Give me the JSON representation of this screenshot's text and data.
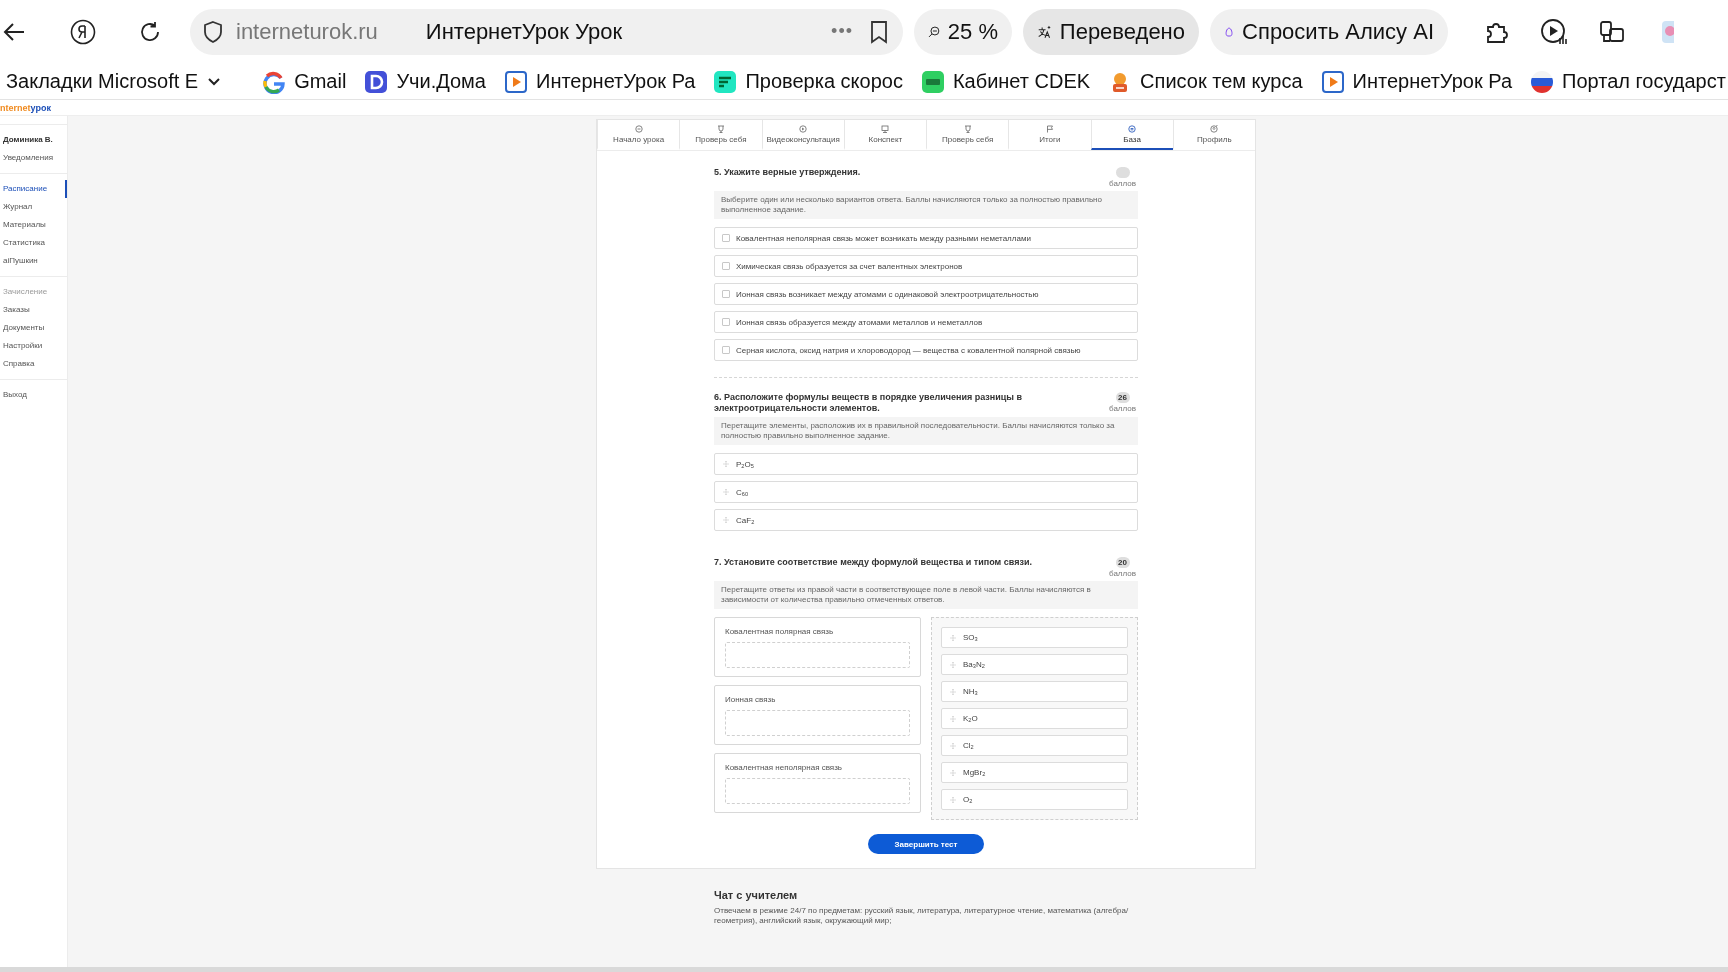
{
  "browser": {
    "host": "interneturok.ru",
    "title": "ИнтернетУрок Урок",
    "more": "•••",
    "zoom": "25 %",
    "translate": "Переведено",
    "alice": "Спросить Алису AI"
  },
  "bookmarks": [
    {
      "label": "Закладки Microsoft E",
      "kind": "folder"
    },
    {
      "label": "Gmail",
      "kind": "ring"
    },
    {
      "label": "Учи.Дома",
      "kind": "tile"
    },
    {
      "label": "ИнтернетУрок Ра",
      "kind": "play"
    },
    {
      "label": "Проверка скорос",
      "kind": "lines"
    },
    {
      "label": "Кабинет CDEK",
      "kind": "square"
    },
    {
      "label": "Список тем курса",
      "kind": "badge"
    },
    {
      "label": "ИнтернетУрок Ра",
      "kind": "play"
    },
    {
      "label": "Портал государст",
      "kind": "flag"
    }
  ],
  "site": {
    "logo_first": "nternet",
    "logo_second": "урок"
  },
  "sidebar": {
    "groups": [
      [
        {
          "label": "Доминика В.",
          "kind": "user",
          "selected": false,
          "disabled": false
        },
        {
          "label": "Уведомления",
          "kind": "item",
          "selected": false,
          "disabled": false
        }
      ],
      [
        {
          "label": "Расписание",
          "kind": "item",
          "selected": true,
          "disabled": false
        },
        {
          "label": "Журнал",
          "kind": "item",
          "selected": false,
          "disabled": false
        },
        {
          "label": "Материалы",
          "kind": "item",
          "selected": false,
          "disabled": false
        },
        {
          "label": "Статистика",
          "kind": "item",
          "selected": false,
          "disabled": false
        },
        {
          "label": "aiПушкин",
          "kind": "item",
          "selected": false,
          "disabled": false
        }
      ],
      [
        {
          "label": "Зачисление",
          "kind": "item",
          "selected": false,
          "disabled": true
        },
        {
          "label": "Заказы",
          "kind": "item",
          "selected": false,
          "disabled": false
        },
        {
          "label": "Документы",
          "kind": "item",
          "selected": false,
          "disabled": false
        },
        {
          "label": "Настройки",
          "kind": "item",
          "selected": false,
          "disabled": false
        },
        {
          "label": "Справка",
          "kind": "item",
          "selected": false,
          "disabled": false
        }
      ],
      [
        {
          "label": "Выход",
          "kind": "item",
          "selected": false,
          "disabled": false
        }
      ]
    ]
  },
  "tabs": [
    {
      "label": "Начало урока",
      "selected": false
    },
    {
      "label": "Проверь себя",
      "selected": false
    },
    {
      "label": "Видеоконсультация",
      "selected": false
    },
    {
      "label": "Конспект",
      "selected": false
    },
    {
      "label": "Проверь себя",
      "selected": false
    },
    {
      "label": "Итоги",
      "selected": false
    },
    {
      "label": "База",
      "selected": true
    },
    {
      "label": "Профиль",
      "selected": false
    }
  ],
  "questions": [
    {
      "kind": "choice",
      "title": "5. Укажите верные утверждения.",
      "points_label": "баллов",
      "hint": "Выберите один или несколько вариантов ответа. Баллы начисляются только за полностью правильно выполненное задание.",
      "options": [
        {
          "text": "Ковалентная неполярная связь может возникать между разными неметаллами",
          "checked": false
        },
        {
          "text": "Химическая связь образуется за счет валентных электронов",
          "checked": false
        },
        {
          "text": "Ионная связь возникает между атомами с одинаковой электроотрицательностью",
          "checked": false
        },
        {
          "text": "Ионная связь образуется между атомами металлов и неметаллов",
          "checked": false
        },
        {
          "text": "Серная кислота, оксид натрия и хлороводород — вещества с ковалентной полярной связью",
          "checked": false
        }
      ]
    },
    {
      "kind": "order",
      "title": "6. Расположите формулы веществ в порядке увеличения разницы в электроотрицательности элементов.",
      "points": "26",
      "points_label": "баллов",
      "hint": "Перетащите элементы, расположив их в правильной последовательности. Баллы начисляются только за полностью правильно выполненное задание.",
      "items": [
        "P$_{2}$O$_{5}$",
        "C$_{60}$",
        "CaF$_{2}$"
      ]
    },
    {
      "kind": "match",
      "title": "7. Установите соответствие между формулой вещества и типом связи.",
      "points": "20",
      "points_label": "баллов",
      "hint": "Перетащите ответы из правой части в соответствующее поле в левой части. Баллы начисляются в зависимости от количества правильно отмеченных ответов.",
      "targets": [
        "Ковалентная полярная связь",
        "Ионная связь",
        "Ковалентная неполярная связь"
      ],
      "answers": [
        "SO$_{3}$",
        "Ba$_{3}$N$_{2}$",
        "NH$_{3}$",
        "K$_{2}$O",
        "Cl$_{2}$",
        "MgBr$_{2}$",
        "O$_{2}$"
      ]
    }
  ],
  "finish_button": "Завершить тест",
  "chat": {
    "title": "Чат с учителем",
    "text": "Отвечаем в режиме 24/7 по предметам: русский язык, литература, литературное чтение, математика (алгебра/геометрия), английский язык, окружающий мир;"
  }
}
